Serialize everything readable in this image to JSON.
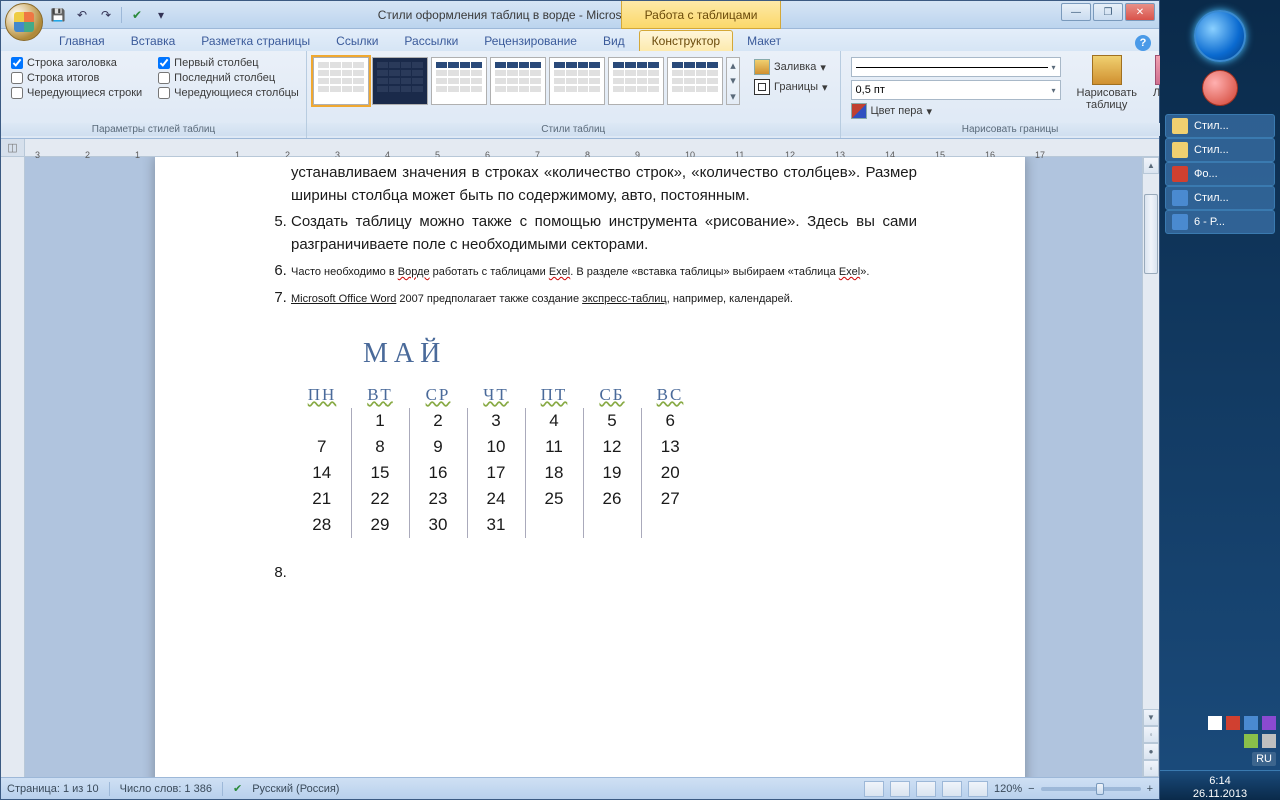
{
  "title": "Стили оформления таблиц в ворде - Microsoft Word",
  "context_title": "Работа с таблицами",
  "qat_tips": [
    "save",
    "undo",
    "redo",
    "spell"
  ],
  "tabs": {
    "home": "Главная",
    "insert": "Вставка",
    "layout_page": "Разметка страницы",
    "references": "Ссылки",
    "mailings": "Рассылки",
    "review": "Рецензирование",
    "view": "Вид",
    "designer": "Конструктор",
    "layout": "Макет"
  },
  "group_styleopts": {
    "label": "Параметры стилей таблиц",
    "col1": {
      "header": "Строка заголовка",
      "total": "Строка итогов",
      "banded_r": "Чередующиеся строки"
    },
    "col2": {
      "first": "Первый столбец",
      "last": "Последний столбец",
      "banded_c": "Чередующиеся столбцы"
    },
    "chk": {
      "header": true,
      "total": false,
      "banded_r": false,
      "first": true,
      "last": false,
      "banded_c": false
    }
  },
  "group_styles": {
    "label": "Стили таблиц",
    "shading": "Заливка",
    "borders": "Границы"
  },
  "group_draw": {
    "label": "Нарисовать границы",
    "weight": "0,5 пт",
    "pen_color": "Цвет пера",
    "draw_table": "Нарисовать таблицу",
    "eraser": "Ластик"
  },
  "ruler_h": [
    "3",
    "2",
    "1",
    "",
    "1",
    "2",
    "3",
    "4",
    "5",
    "6",
    "7",
    "8",
    "9",
    "10",
    "11",
    "12",
    "13",
    "14",
    "15",
    "16",
    "17"
  ],
  "document": {
    "para_top": "устанавливаем значения в строках «количество строк», «количество столбцев». Размер ширины столбца может быть по содержимому, авто, постоянным.",
    "li5": "Создать таблицу можно также с помощью инструмента «рисование». Здесь вы сами разграничиваете поле с необходимыми секторами.",
    "li6_a": "Часто необходимо в ",
    "li6_w1": "Ворде",
    "li6_b": " работать с таблицами ",
    "li6_w2": "Exel",
    "li6_c": ". В разделе «вставка таблицы» выбираем «таблица ",
    "li6_w3": "Exel",
    "li6_d": "».",
    "li7_a": "Microsoft Office Word",
    "li7_b": " 2007 предполагает также создание ",
    "li7_c": "экспресс-таблиц",
    "li7_d": ", например, календарей.",
    "li8": "",
    "cal_title": "МАЙ",
    "cal_head": [
      "ПН",
      "ВТ",
      "СР",
      "ЧТ",
      "ПТ",
      "СБ",
      "ВС"
    ],
    "cal_rows": [
      [
        "",
        "1",
        "2",
        "3",
        "4",
        "5",
        "6"
      ],
      [
        "7",
        "8",
        "9",
        "10",
        "11",
        "12",
        "13"
      ],
      [
        "14",
        "15",
        "16",
        "17",
        "18",
        "19",
        "20"
      ],
      [
        "21",
        "22",
        "23",
        "24",
        "25",
        "26",
        "27"
      ],
      [
        "28",
        "29",
        "30",
        "31",
        "",
        "",
        ""
      ]
    ]
  },
  "status": {
    "page": "Страница: 1 из 10",
    "words": "Число слов: 1 386",
    "lang": "Русский (Россия)",
    "zoom": "120%"
  },
  "sidebar_items": [
    {
      "cls": "",
      "label": "Стил..."
    },
    {
      "cls": "",
      "label": "Стил..."
    },
    {
      "cls": "red",
      "label": "Фо..."
    },
    {
      "cls": "blue",
      "label": "Стил..."
    },
    {
      "cls": "blue",
      "label": "6 - P..."
    }
  ],
  "clock": {
    "time": "6:14",
    "date": "26.11.2013"
  },
  "lang_ind": "RU"
}
